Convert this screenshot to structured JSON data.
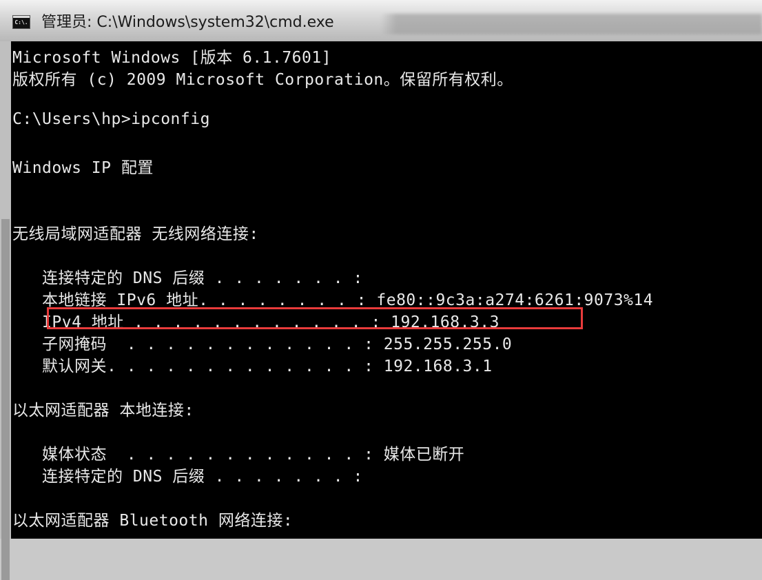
{
  "window": {
    "title": "管理员: C:\\Windows\\system32\\cmd.exe",
    "icon": "cmd-icon",
    "icon_text": "C:\\."
  },
  "console": {
    "lines": [
      "Microsoft Windows [版本 6.1.7601]",
      "版权所有 (c) 2009 Microsoft Corporation。保留所有权利。",
      "",
      "C:\\Users\\hp>ipconfig",
      "",
      "Windows IP 配置",
      "",
      "",
      "无线局域网适配器 无线网络连接:",
      "",
      "   连接特定的 DNS 后缀 . . . . . . . :",
      "   本地链接 IPv6 地址. . . . . . . . : fe80::9c3a:a274:6261:9073%14",
      "   IPv4 地址 . . . . . . . . . . . . : 192.168.3.3",
      "   子网掩码  . . . . . . . . . . . . : 255.255.255.0",
      "   默认网关. . . . . . . . . . . . . : 192.168.3.1",
      "",
      "以太网适配器 本地连接:",
      "",
      "   媒体状态  . . . . . . . . . . . . : 媒体已断开",
      "   连接特定的 DNS 后缀 . . . . . . . :",
      "",
      "以太网适配器 Bluetooth 网络连接:"
    ],
    "highlighted_line_index": 12,
    "highlight_color": "#e83b3b"
  }
}
